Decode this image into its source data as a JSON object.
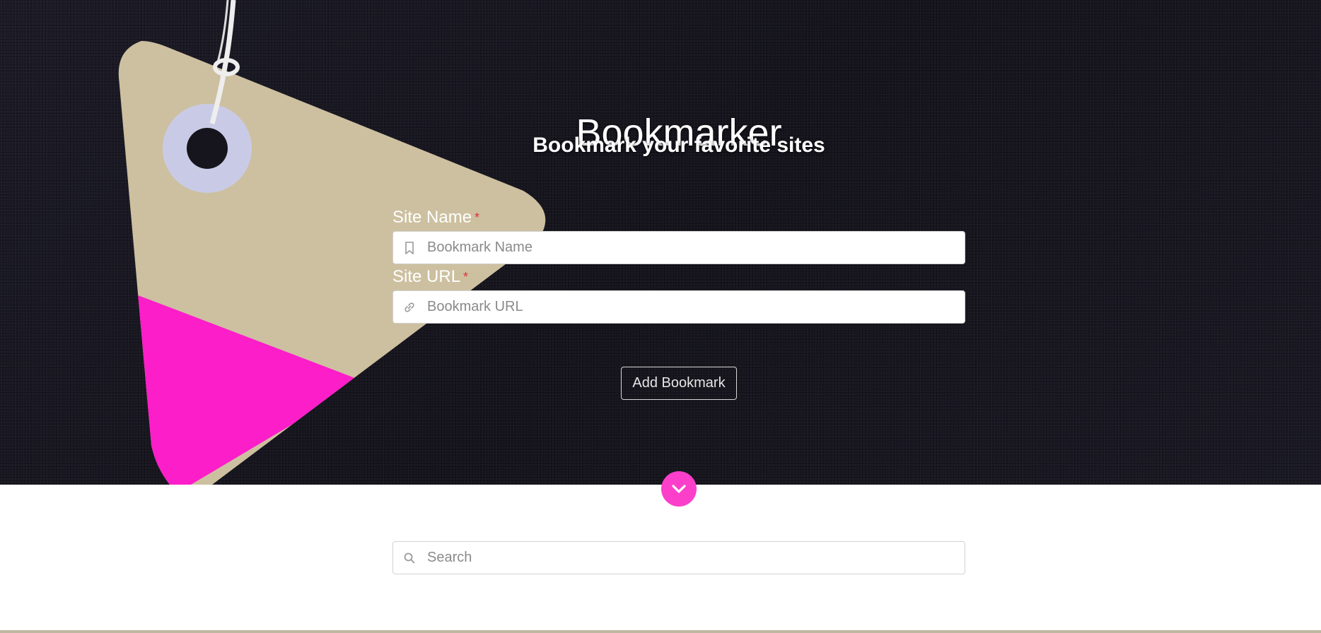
{
  "header": {
    "title": "Bookmarker",
    "subtitle": "Bookmark your favorite sites"
  },
  "form": {
    "site_name": {
      "label": "Site Name",
      "required_mark": "*",
      "placeholder": "Bookmark Name",
      "value": "",
      "icon": "bookmark-icon"
    },
    "site_url": {
      "label": "Site URL",
      "required_mark": "*",
      "placeholder": "Bookmark URL",
      "value": "",
      "icon": "link-icon"
    },
    "submit_label": "Add Bookmark"
  },
  "scroll_button": {
    "icon": "chevron-down-icon"
  },
  "search": {
    "placeholder": "Search",
    "value": "",
    "icon": "search-icon"
  },
  "colors": {
    "accent": "#fc3fcb",
    "hero_background": "#17161f",
    "tag": "#cdc0a0",
    "tag_stripe": "#fc1ec9",
    "required": "#e0303a"
  }
}
